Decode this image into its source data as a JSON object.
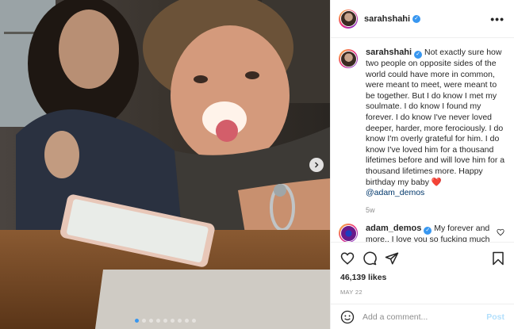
{
  "post": {
    "author": "sarahshahi",
    "more_label": "•••",
    "image_alt": "Selfie of a smiling couple at a table",
    "carousel": {
      "total": 9,
      "active": 0
    }
  },
  "caption": {
    "username": "sarahshahi",
    "text": "Not exactly sure how two people on opposite sides of the world could have more in common, were meant to meet, were meant to be together. But I do know I met my soulmate. I do know I found my forever. I do know I've never loved deeper, harder, more ferociously. I do know I'm overly grateful for him. I do know I've loved him for a thousand lifetimes before and will love him for a thousand lifetimes more. Happy birthday my baby",
    "heart": "❤️",
    "mention": "@adam_demos",
    "time": "5w"
  },
  "reply": {
    "username": "adam_demos",
    "text": "My forever and more.. I love you so fucking much my baby",
    "hearts": "❤️❤️❤️❤️"
  },
  "likes_label": "46,139 likes",
  "date_label": "MAY 22",
  "comment_box": {
    "placeholder": "Add a comment...",
    "post_label": "Post"
  },
  "colors": {
    "verified": "#3897f0",
    "link": "#00376b",
    "post_button": "#b2dffc",
    "heart": "#e0245e"
  }
}
